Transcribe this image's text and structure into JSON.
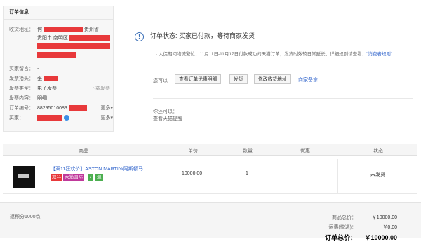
{
  "order_info": {
    "header": "订单信息",
    "address_label": "收货地址：",
    "address_v1": "何",
    "address_v2": "贵州省",
    "address_v3": "贵阳市 南明区",
    "message_label": "买家留言：",
    "message_value": "-",
    "invoice_head_label": "发票抬头：",
    "invoice_head_value": "张",
    "invoice_type_label": "发票类型：",
    "invoice_type_value": "电子发票",
    "invoice_download": "下载发票",
    "invoice_content_label": "发票内容：",
    "invoice_content_value": "明细",
    "order_no_label": "订单编号：",
    "order_no_value": "88295010083",
    "more1": "更多",
    "buyer_label": "买家：",
    "more2": "更多"
  },
  "status": {
    "icon": "info-icon",
    "title": "订单状态: 买家已付款，等待商家发货",
    "notice": "· 大促期间物流繁忙，11月11日-11月17日付款成功的天猫订单，发货时效较日常延长，详细规则请查看：",
    "notice_link": "\"消费者规则\""
  },
  "ops": {
    "label": "您可以",
    "btn_detail": "查看订单优惠明细",
    "btn_ship": "发货",
    "btn_modify": "修改收货地址",
    "link_note": "商家备忘"
  },
  "also": {
    "label": "你还可以：",
    "remind": "查看天猫提醒"
  },
  "table": {
    "headers": [
      "商品",
      "单价",
      "数量",
      "优惠",
      "状态"
    ],
    "row": {
      "title": "【双11狂欢价】ASTON MARTIN/阿斯顿马...",
      "badges": [
        "双11",
        "天猫国际",
        "7",
        "退"
      ],
      "price": "10000.00",
      "qty": "1",
      "state": "未发货"
    }
  },
  "footer": {
    "points": "返积分1000点",
    "total_goods_label": "商品总价：",
    "total_goods_value": "￥10000.00",
    "shipping_label": "运费(快递)：",
    "shipping_value": "￥0.00",
    "total_label": "订单总价：",
    "total_value": "￥10000.00"
  }
}
